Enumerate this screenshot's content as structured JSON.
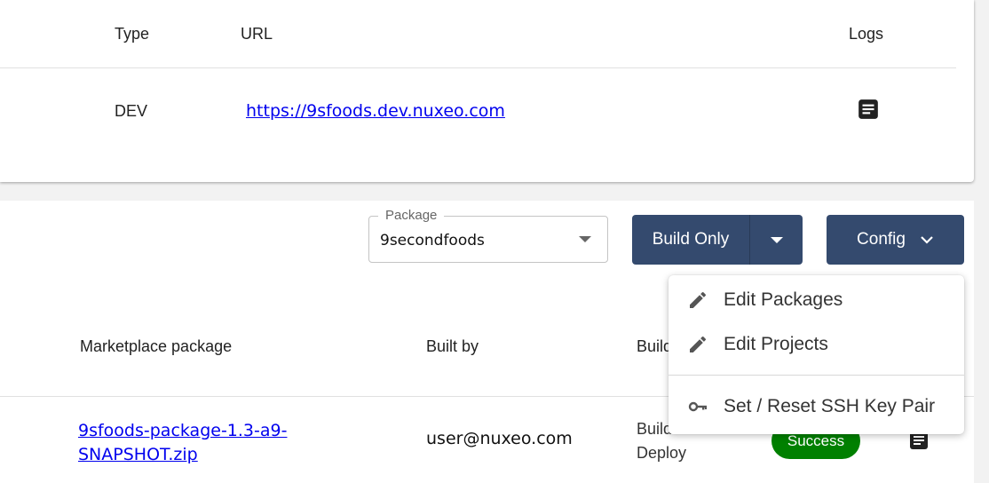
{
  "environments_table": {
    "headers": {
      "type": "Type",
      "url": "URL",
      "logs": "Logs"
    },
    "rows": [
      {
        "type": "DEV",
        "url": "https://9sfoods.dev.nuxeo.com",
        "logs_icon": "log-document-icon"
      }
    ]
  },
  "toolbar": {
    "package_select": {
      "label": "Package",
      "value": "9secondfoods"
    },
    "build_button_label": "Build Only",
    "config_button_label": "Config"
  },
  "builds_table": {
    "headers": {
      "package": "Marketplace package",
      "built_by": "Built by",
      "build_type": "Build"
    },
    "rows": [
      {
        "package_line1": "9sfoods-package-1.3-a9-",
        "package_line2": "SNAPSHOT.zip",
        "built_by": "user@nuxeo.com",
        "type_line1": "Build",
        "type_line2": "Deploy",
        "status": "Success",
        "logs_icon": "log-document-icon"
      }
    ]
  },
  "config_menu": {
    "items": [
      {
        "label": "Edit Packages",
        "icon": "pencil-icon"
      },
      {
        "label": "Edit Projects",
        "icon": "pencil-icon"
      },
      {
        "label": "Set / Reset SSH Key Pair",
        "icon": "key-icon"
      }
    ]
  },
  "colors": {
    "primary_button": "#344a6e",
    "link": "#0000ee",
    "success": "#008000"
  }
}
